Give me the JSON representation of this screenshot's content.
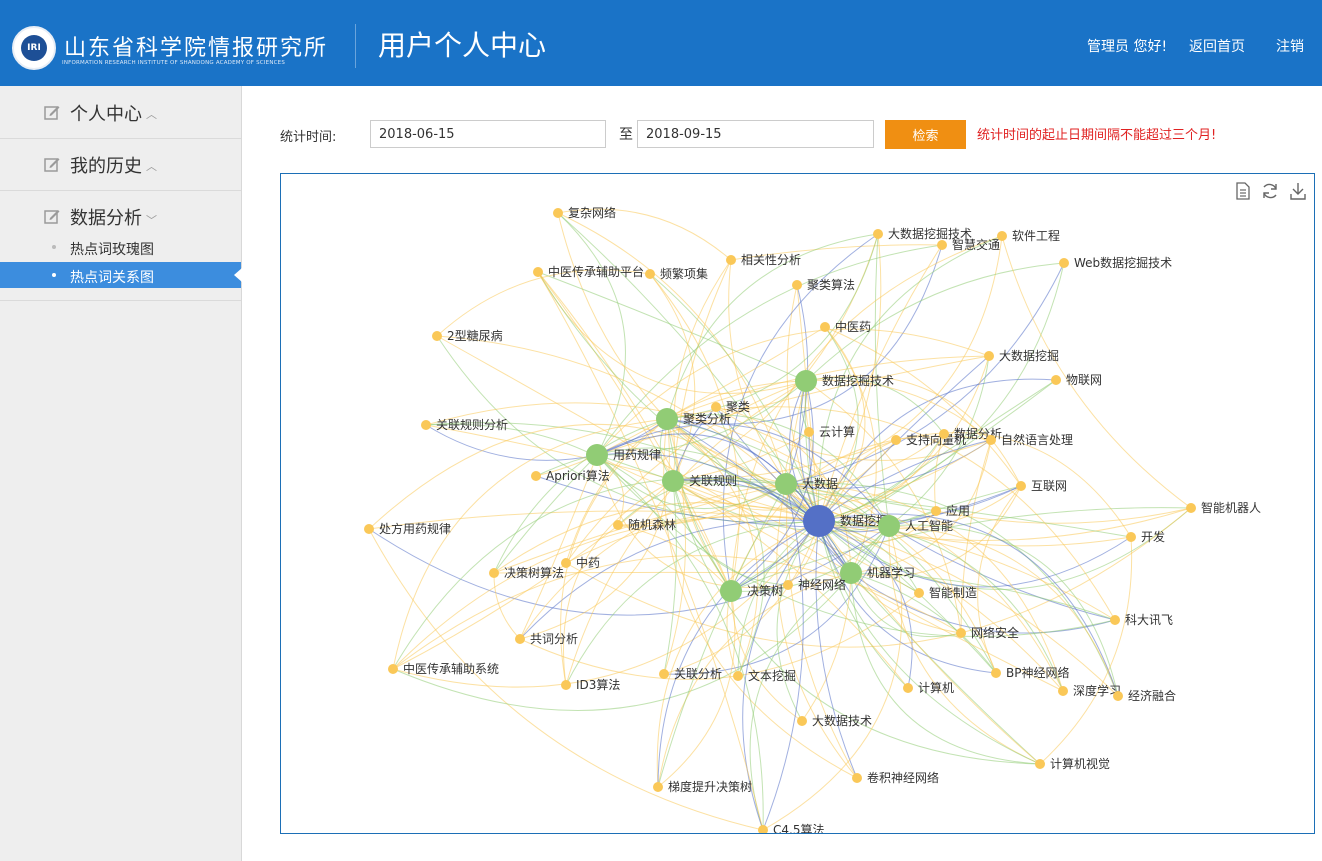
{
  "header": {
    "org_name_cn": "山东省科学院情报研究所",
    "org_name_en": "INFORMATION RESEARCH INSTITUTE OF SHANDONG ACADEMY OF SCIENCES",
    "logo_text": "IRI",
    "page_title": "用户个人中心",
    "greeting": "管理员 您好!",
    "home_link": "返回首页",
    "logout_link": "注销",
    "color": "#1a73c7"
  },
  "sidebar": {
    "menus": [
      {
        "label": "个人中心",
        "expanded": false
      },
      {
        "label": "我的历史",
        "expanded": false
      },
      {
        "label": "数据分析",
        "expanded": true
      }
    ],
    "subitems": [
      {
        "label": "热点词玫瑰图",
        "active": false
      },
      {
        "label": "热点词关系图",
        "active": true
      }
    ],
    "active_color": "#3c8dde"
  },
  "filter": {
    "label": "统计时间:",
    "start_date": "2018-06-15",
    "to_label": "至",
    "end_date": "2018-09-15",
    "search_button": "检索",
    "warning": "统计时间的起止日期间隔不能超过三个月!",
    "button_color": "#f08f12",
    "warning_color": "#e02222"
  },
  "toolbox": {
    "icons": [
      "data-view-icon",
      "restore-icon",
      "download-icon"
    ]
  },
  "chart_data": {
    "type": "graph",
    "colors": {
      "center": "#5470c6",
      "hub": "#91cc75",
      "leaf": "#fac858"
    },
    "nodes": [
      {
        "name": "数据挖掘",
        "cat": "center"
      },
      {
        "name": "数据挖掘技术",
        "cat": "hub"
      },
      {
        "name": "聚类分析",
        "cat": "hub"
      },
      {
        "name": "用药规律",
        "cat": "hub"
      },
      {
        "name": "关联规则",
        "cat": "hub"
      },
      {
        "name": "大数据",
        "cat": "hub"
      },
      {
        "name": "人工智能",
        "cat": "hub"
      },
      {
        "name": "机器学习",
        "cat": "hub"
      },
      {
        "name": "决策树",
        "cat": "hub"
      },
      {
        "name": "复杂网络",
        "cat": "leaf"
      },
      {
        "name": "中医传承辅助平台",
        "cat": "leaf"
      },
      {
        "name": "频繁项集",
        "cat": "leaf"
      },
      {
        "name": "相关性分析",
        "cat": "leaf"
      },
      {
        "name": "聚类算法",
        "cat": "leaf"
      },
      {
        "name": "大数据挖掘技术",
        "cat": "leaf"
      },
      {
        "name": "智慧交通",
        "cat": "leaf"
      },
      {
        "name": "软件工程",
        "cat": "leaf"
      },
      {
        "name": "Web数据挖掘技术",
        "cat": "leaf"
      },
      {
        "name": "2型糖尿病",
        "cat": "leaf"
      },
      {
        "name": "中医药",
        "cat": "leaf"
      },
      {
        "name": "大数据挖掘",
        "cat": "leaf"
      },
      {
        "name": "物联网",
        "cat": "leaf"
      },
      {
        "name": "聚类",
        "cat": "leaf"
      },
      {
        "name": "关联规则分析",
        "cat": "leaf"
      },
      {
        "name": "云计算",
        "cat": "leaf"
      },
      {
        "name": "支持向量机",
        "cat": "leaf"
      },
      {
        "name": "数据分析",
        "cat": "leaf"
      },
      {
        "name": "自然语言处理",
        "cat": "leaf"
      },
      {
        "name": "Apriori算法",
        "cat": "leaf"
      },
      {
        "name": "互联网",
        "cat": "leaf"
      },
      {
        "name": "智能机器人",
        "cat": "leaf"
      },
      {
        "name": "应用",
        "cat": "leaf"
      },
      {
        "name": "处方用药规律",
        "cat": "leaf"
      },
      {
        "name": "随机森林",
        "cat": "leaf"
      },
      {
        "name": "开发",
        "cat": "leaf"
      },
      {
        "name": "中药",
        "cat": "leaf"
      },
      {
        "name": "决策树算法",
        "cat": "leaf"
      },
      {
        "name": "神经网络",
        "cat": "leaf"
      },
      {
        "name": "智能制造",
        "cat": "leaf"
      },
      {
        "name": "科大讯飞",
        "cat": "leaf"
      },
      {
        "name": "共词分析",
        "cat": "leaf"
      },
      {
        "name": "网络安全",
        "cat": "leaf"
      },
      {
        "name": "中医传承辅助系统",
        "cat": "leaf"
      },
      {
        "name": "关联分析",
        "cat": "leaf"
      },
      {
        "name": "文本挖掘",
        "cat": "leaf"
      },
      {
        "name": "BP神经网络",
        "cat": "leaf"
      },
      {
        "name": "ID3算法",
        "cat": "leaf"
      },
      {
        "name": "计算机",
        "cat": "leaf"
      },
      {
        "name": "深度学习",
        "cat": "leaf"
      },
      {
        "name": "经济融合",
        "cat": "leaf"
      },
      {
        "name": "大数据技术",
        "cat": "leaf"
      },
      {
        "name": "计算机视觉",
        "cat": "leaf"
      },
      {
        "name": "卷积神经网络",
        "cat": "leaf"
      },
      {
        "name": "梯度提升决策树",
        "cat": "leaf"
      },
      {
        "name": "C4.5算法",
        "cat": "leaf"
      }
    ]
  }
}
